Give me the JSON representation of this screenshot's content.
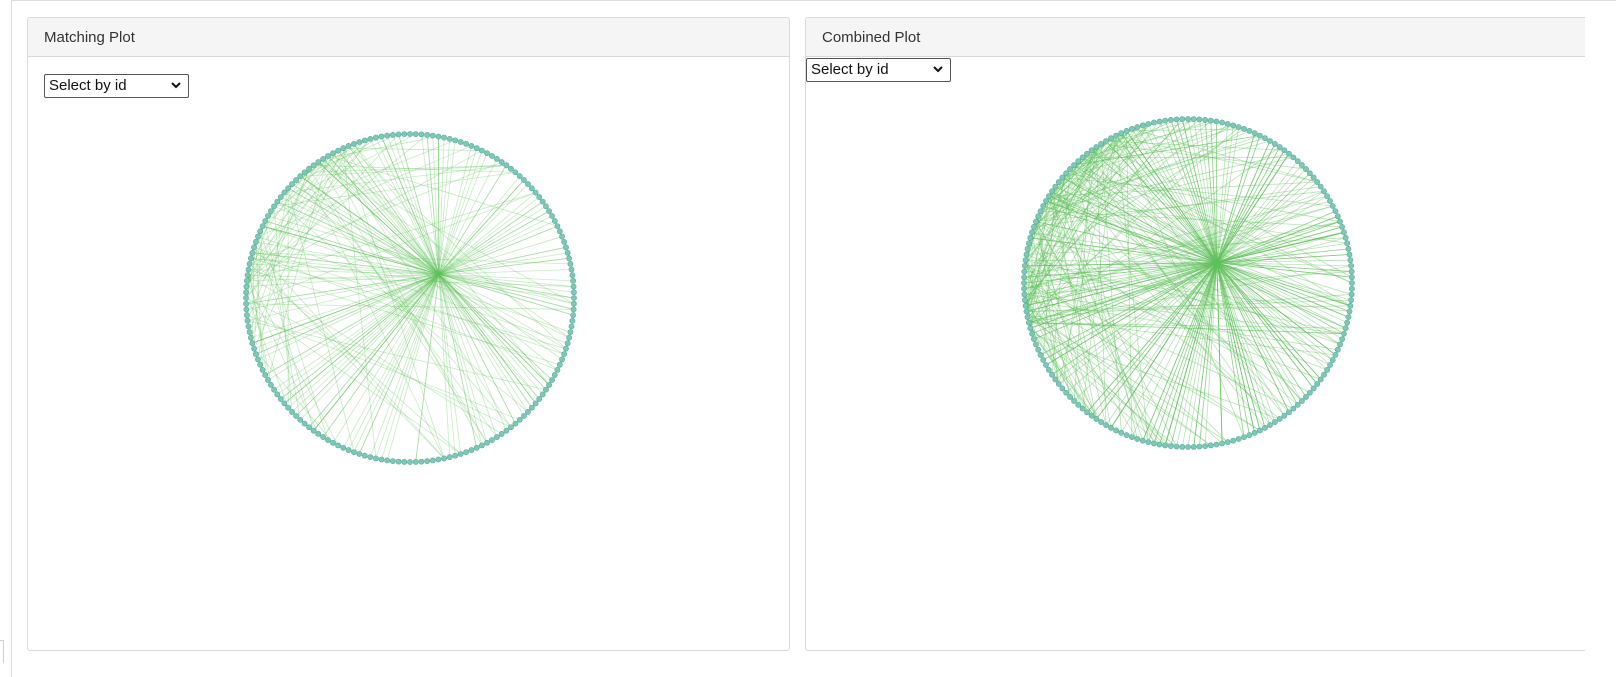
{
  "panels": [
    {
      "title": "Matching Plot",
      "select_value": "Select by id",
      "hub_fraction": [
        0.585,
        0.43
      ]
    },
    {
      "title": "Combined Plot",
      "select_value": "Select by id",
      "hub_fraction": [
        0.585,
        0.44
      ]
    }
  ],
  "colors": {
    "edge": "#5fc25a",
    "node_fill": "#7dc9b3",
    "node_stroke": "#5aa9a0",
    "header_bg": "#f5f5f5",
    "border": "#d9d9d9"
  },
  "icons": {
    "select_arrow": "chevron-down-icon"
  }
}
